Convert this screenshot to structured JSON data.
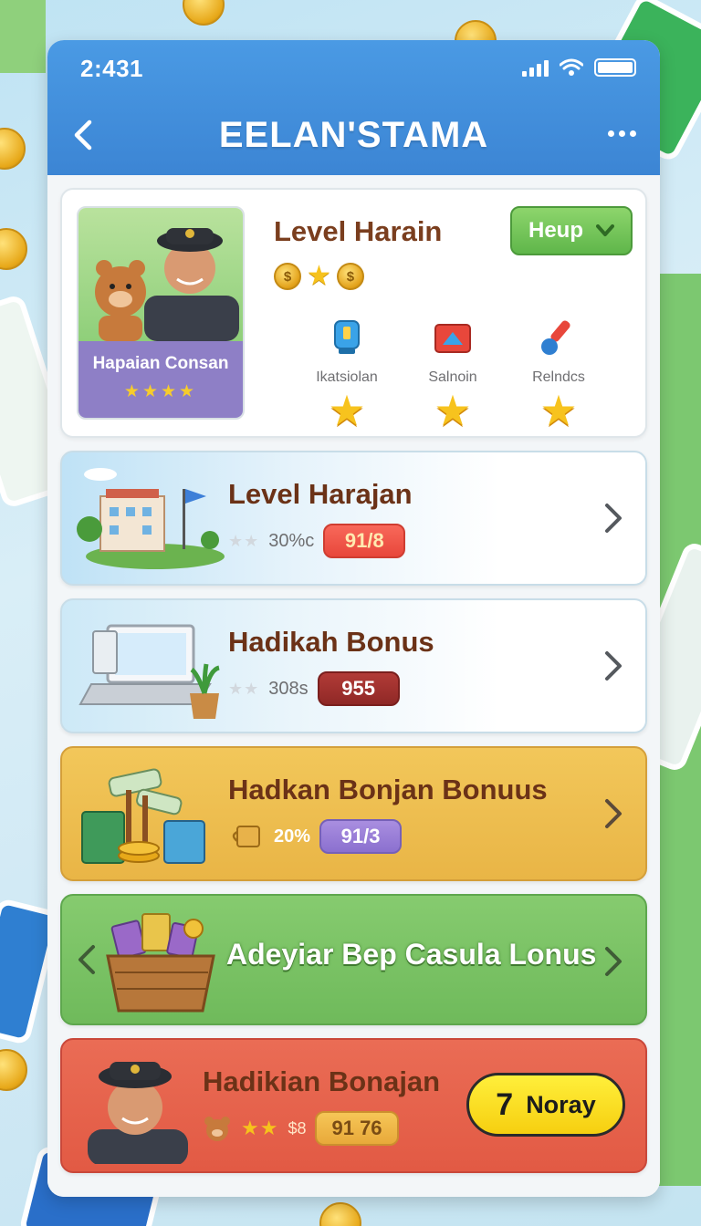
{
  "status_bar": {
    "time": "2:431"
  },
  "header": {
    "title": "EELAN'STAMA"
  },
  "profile": {
    "level_title": "Level Harain",
    "help_label": "Heup",
    "avatar_name": "Hapaian Consan",
    "avatar_stars": "★★★★",
    "coins": [
      "$",
      "★",
      "$"
    ],
    "skills": [
      {
        "label": "Ikatsiolan",
        "icon": "trophy-icon"
      },
      {
        "label": "Salnoin",
        "icon": "card-icon"
      },
      {
        "label": "Relndcs",
        "icon": "brush-icon"
      }
    ]
  },
  "cards": [
    {
      "title": "Level Harajan",
      "meta": "30%c",
      "stars": "★★",
      "pill": "91/8",
      "illustration": "school-icon"
    },
    {
      "title": "Hadikah Bonus",
      "meta": "308s",
      "stars": "★★",
      "pill": "955",
      "illustration": "laptop-icon"
    },
    {
      "title": "Hadkan Bonjan Bonuus",
      "meta": "20%",
      "pill": "91/3",
      "illustration": "money-pile-icon"
    },
    {
      "title": "Adeyiar Bep Casula Lonus",
      "illustration": "basket-icon"
    },
    {
      "title": "Hadikian Bonajan",
      "meta": "$8",
      "stars": "★★",
      "pill": "91 76",
      "button_num": "7",
      "button_label": "Noray",
      "illustration": "officer-avatar"
    }
  ],
  "colors": {
    "header": "#3c85d4",
    "accent_green": "#5fb64a",
    "gold": "#e9b546",
    "red": "#e25a44"
  }
}
